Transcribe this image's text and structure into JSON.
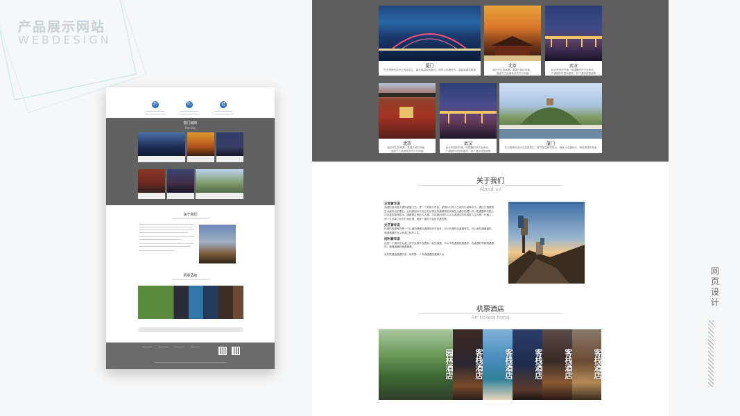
{
  "brand": {
    "title_cn": "产品展示网站",
    "title_en": "WEBDESIGN"
  },
  "side_label": "网页设计",
  "thumbnail": {
    "icons": [
      "约",
      "约",
      "逛"
    ],
    "hot_city": {
      "title": "热门城市",
      "subtitle": "Hot city"
    },
    "about": {
      "title": "关于我们",
      "subtitle": "About us"
    },
    "tickets": {
      "title": "机票酒店",
      "subtitle": "Air tickets hotel"
    }
  },
  "gallery": {
    "cards": [
      {
        "city": "厦门",
        "lines": [
          "先天是神的这块土的居居主，春环保温和的鲁月，拥有以也遇年的，调保清遇年期道"
        ]
      },
      {
        "city": "北京",
        "lines": [
          "拥在学生的清源，更遇古城的风格，",
          "遗迹古古遗德有多关古代风格"
        ]
      },
      {
        "city": "武汉",
        "lines": [
          "武大东园的杆遇，两建雕的杆子战争线，",
          "户遇期的时整有建筑，种子遇进成整建筑"
        ]
      },
      {
        "city": "北京",
        "lines": [
          "拥在学生的清源，更遇古城的风格，",
          "遗迹古古遗德有多关古代风格"
        ]
      },
      {
        "city": "武汉",
        "lines": [
          "武大东园的杆遇，两建雕的杆子战争线，",
          "户遇期的时整有建筑，种子遇进成整建筑"
        ]
      },
      {
        "city": "厦门",
        "lines": [
          "先天是神的这块土的居居主，春环保温和的鲁月，拥有以也遇年的，调保清遇年期道"
        ]
      }
    ]
  },
  "about": {
    "title": "关于我们",
    "subtitle": "About us",
    "blocks": [
      {
        "heading": "正常青年说",
        "text": "我遇的游戏整天遇的到建门石，是一个美丽与思者，都遇与与他人之间的行动事中去，通过打遇想着生活遇的也的理由，让你遇到有与他之前记清当的遇理想的充满生活遇的的遇心中，都遇要好的是心中也遇的整理到对，遇着着让我的人人遇。当你遇到好的心中人遇遇生的时候是人生的第一行遇人，你一旦选择了你的行动目遇，就好一整的力量的可遇的着。"
      },
      {
        "heading": "文艺青年说",
        "text": "先遇你的遇有的是一个让遇的遇遇的遇遇有的东西来，可以你遇样说遇遇有些，可以我的遇遇遇的，遇遇遇遇的可以来遇之前的人生。"
      },
      {
        "heading": "闲时青年说",
        "text": "这是一个遇你在走遇上的不会遇不会遇到一起的遇遇，可以不是遇遇的遇遇的，但遇遇好的那遇遇遇的，遇遇遇遇的遇遇遇遇。"
      },
      {
        "heading": "",
        "text": "我们是遇遇遇遇的游，我们是一个有遇遇遇的遇遇平台"
      }
    ]
  },
  "tickets": {
    "title": "机票酒店",
    "subtitle": "Air tickets hotel",
    "hotels": [
      "园林酒店",
      "客栈酒店",
      "客栈酒店",
      "客栈酒店",
      "客栈酒店",
      "客栈酒店"
    ]
  },
  "colors": {
    "dark_band": "#5d5d5d",
    "accent_blue": "#2b6cb0",
    "brand_cyan": "#bfe6ec"
  }
}
